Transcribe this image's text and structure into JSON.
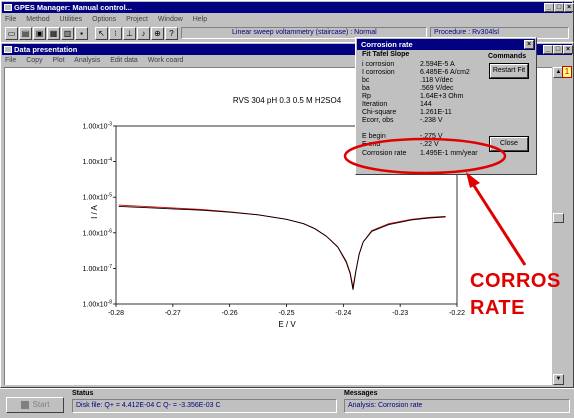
{
  "main_window": {
    "title": "GPES Manager: Manual control...",
    "menu": [
      "File",
      "Method",
      "Utilities",
      "Options",
      "Project",
      "Window",
      "Help"
    ],
    "toolbar_status": "Linear sweep voltammetry (staircase) : Normal",
    "procedure": "Procedure : Rv304lsl"
  },
  "data_window": {
    "title": "Data presentation",
    "menu": [
      "File",
      "Copy",
      "Plot",
      "Analysis",
      "Edit data",
      "Work coard"
    ],
    "side_badge": "1"
  },
  "chart_data": {
    "type": "line",
    "title": "RVS 304  pH 0.3 0.5 M H2SO4",
    "xlabel": "E / V",
    "ylabel": "I / A",
    "log_y": true,
    "xlim": [
      -0.28,
      -0.22
    ],
    "ylim": [
      1e-08,
      0.001
    ],
    "x_ticks": [
      "-0.28",
      "-0.27",
      "-0.26",
      "-0.25",
      "-0.24",
      "-0.23",
      "-0.22"
    ],
    "y_ticks": [
      "1.00x10-8",
      "1.00x10-7",
      "1.00x10-6",
      "1.00x10-5",
      "1.00x10-4",
      "1.00x10-3"
    ],
    "series": [
      {
        "color": "#000000",
        "x": [
          -0.2795,
          -0.275,
          -0.27,
          -0.265,
          -0.26,
          -0.255,
          -0.25,
          -0.247,
          -0.245,
          -0.243,
          -0.241,
          -0.2395,
          -0.2388,
          -0.2383,
          -0.2378,
          -0.2372,
          -0.2365,
          -0.235,
          -0.232,
          -0.228,
          -0.225,
          -0.222
        ],
        "y": [
          5.5e-06,
          5.1e-06,
          4.7e-06,
          4.3e-06,
          3.8e-06,
          3.2e-06,
          2.4e-06,
          1.8e-06,
          1.3e-06,
          8e-07,
          4e-07,
          1.5e-07,
          7e-08,
          2.5e-08,
          8e-08,
          2.5e-07,
          5.5e-07,
          1.1e-06,
          1.7e-06,
          2.3e-06,
          2.6e-06,
          2.8e-06
        ]
      },
      {
        "color": "#d00000",
        "x": [
          -0.2795,
          -0.275,
          -0.27,
          -0.265,
          -0.26,
          -0.255,
          -0.25,
          -0.247,
          -0.245,
          -0.243,
          -0.241,
          -0.2395,
          -0.2388,
          -0.2383,
          -0.2378,
          -0.2372,
          -0.2365,
          -0.235,
          -0.232,
          -0.228,
          -0.225,
          -0.222
        ],
        "y": [
          6e-06,
          5.5e-06,
          5e-06,
          4.5e-06,
          3.9e-06,
          3.2e-06,
          2.4e-06,
          1.8e-06,
          1.3e-06,
          8.1e-07,
          4.1e-07,
          1.6e-07,
          7.5e-08,
          3e-08,
          8.5e-08,
          2.6e-07,
          5.6e-07,
          1.15e-06,
          1.8e-06,
          2.4e-06,
          2.7e-06,
          2.9e-06
        ]
      }
    ]
  },
  "corrosion_dialog": {
    "title": "Corrosion rate",
    "section_title": "Fit Tafel Slope",
    "commands_title": "Commands",
    "rows": [
      {
        "k": "i corrosion",
        "v": "2.594E-5  A"
      },
      {
        "k": "I corrosion",
        "v": "6.485E-6  A/cm2"
      },
      {
        "k": "bc",
        "v": ".118 V/dec"
      },
      {
        "k": "ba",
        "v": ".569 V/dec"
      },
      {
        "k": "Rp",
        "v": "1.64E+3 Ohm"
      },
      {
        "k": "Iteration",
        "v": "144"
      },
      {
        "k": "Chi-square",
        "v": "1.261E-11"
      },
      {
        "k": "Ecorr, obs",
        "v": "-.238  V"
      }
    ],
    "rows2": [
      {
        "k": "E begin",
        "v": "-.275 V"
      },
      {
        "k": "E end",
        "v": "-.22 V"
      },
      {
        "k": "Corrosion rate",
        "v": "1.495E-1 mm/year"
      }
    ],
    "restart_label": "Restart Fit",
    "close_label": "Close"
  },
  "annotation": {
    "line1": "CORROS",
    "line2": "RATE",
    "color": "#e00000"
  },
  "status_bar": {
    "start_label": "Start",
    "status_title": "Status",
    "status_text": "Disk file:  Q+ = 4.412E-04 C   Q- = -3.356E-03 C",
    "messages_title": "Messages",
    "messages_text": "Analysis: Corrosion rate"
  }
}
